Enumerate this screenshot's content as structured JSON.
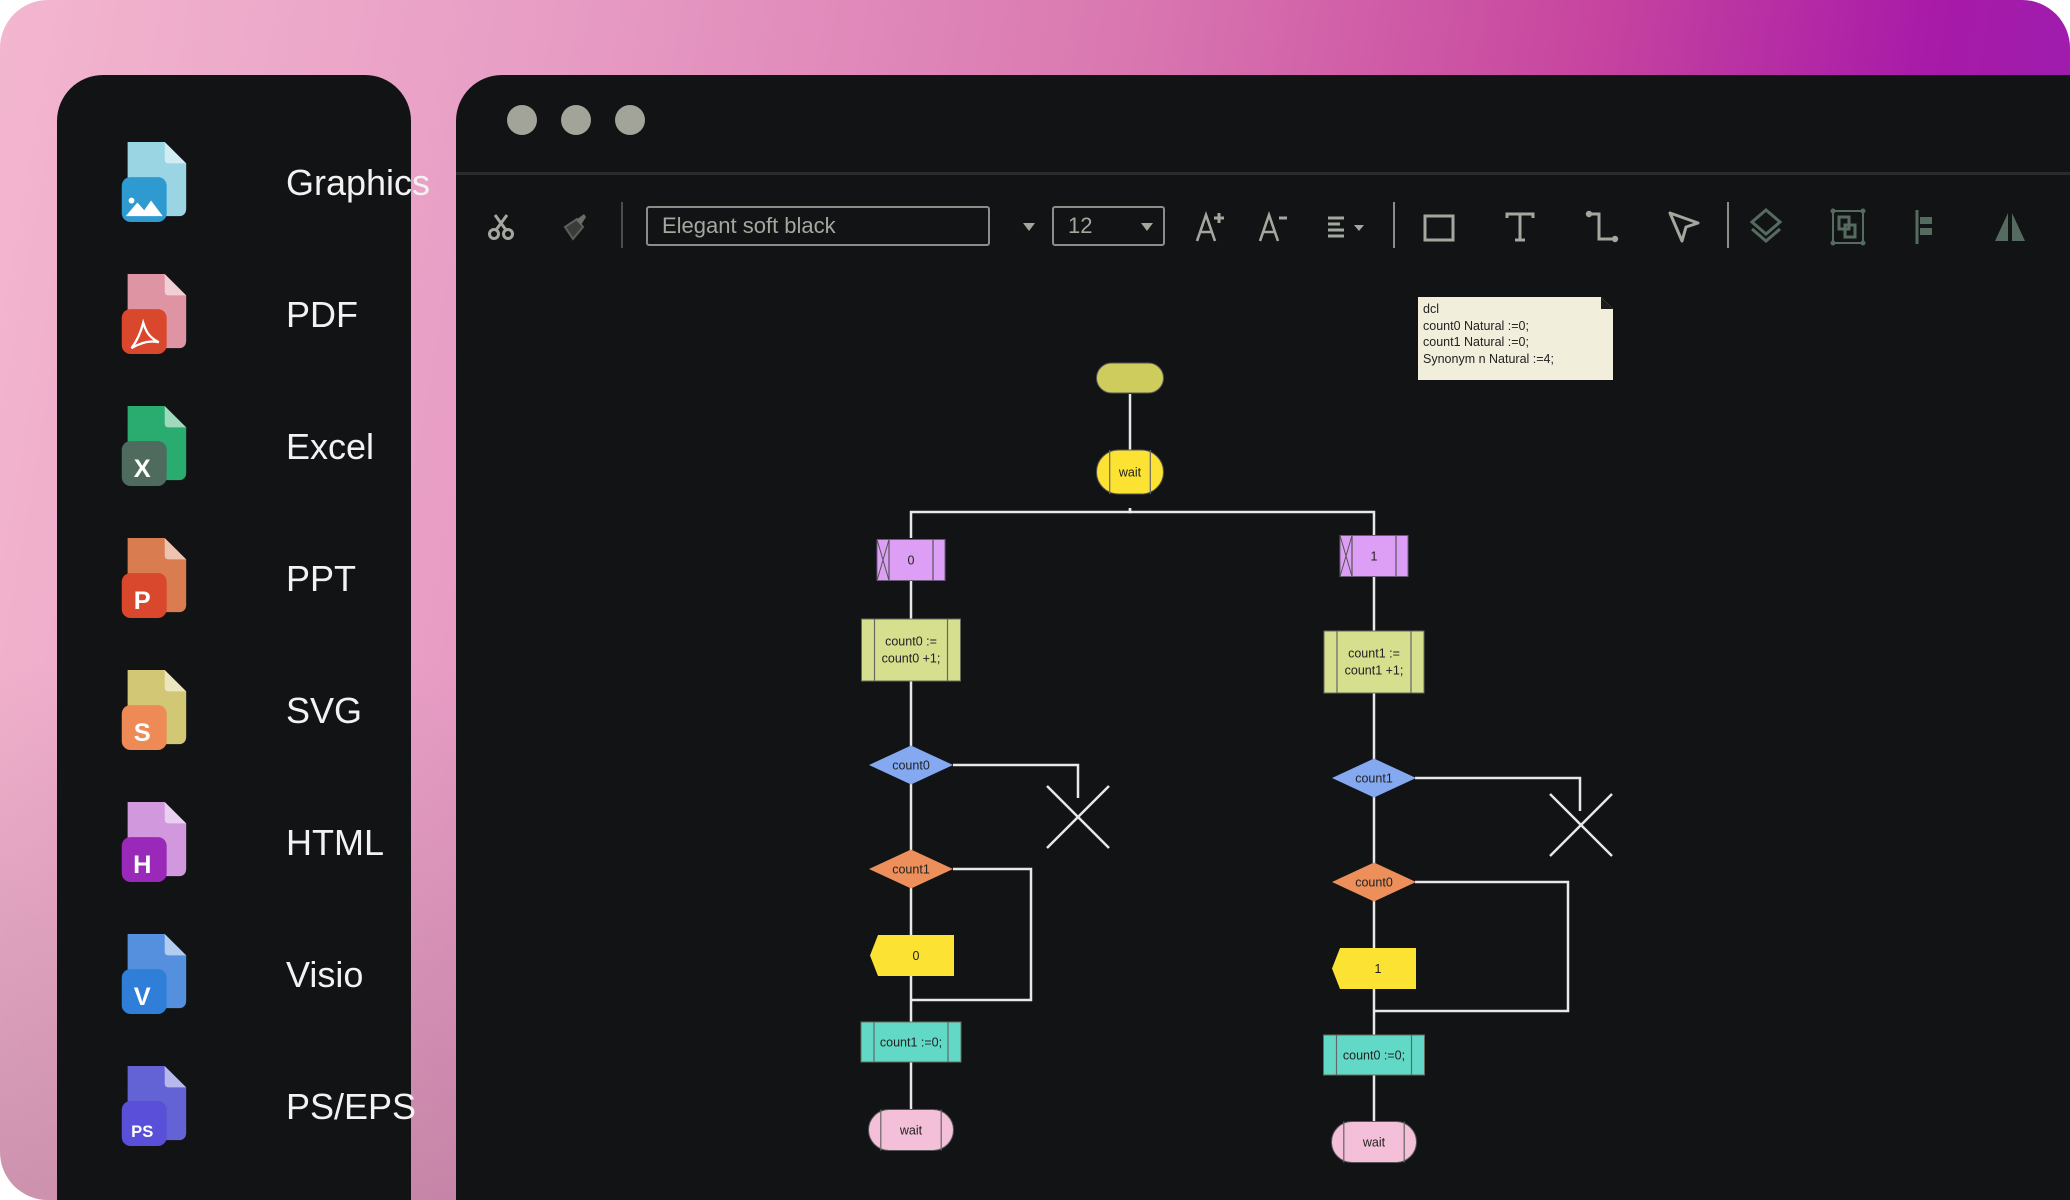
{
  "window": {
    "traffic_lights": [
      "close",
      "minimize",
      "maximize"
    ]
  },
  "sidebar": {
    "items": [
      {
        "label": "Graphics",
        "icon": "graphics-file-icon",
        "badge": "",
        "back_color": "#a6e6f5",
        "badge_color": "#2f9ad0"
      },
      {
        "label": "PDF",
        "icon": "pdf-file-icon",
        "badge": "",
        "back_color": "#f0a0b0",
        "badge_color": "#d9472c"
      },
      {
        "label": "Excel",
        "icon": "excel-file-icon",
        "badge": "X",
        "back_color": "#2db878",
        "badge_color": "#4e6b5d"
      },
      {
        "label": "PPT",
        "icon": "ppt-file-icon",
        "badge": "P",
        "back_color": "#ea8656",
        "badge_color": "#d9472c"
      },
      {
        "label": "SVG",
        "icon": "svg-file-icon",
        "badge": "S",
        "back_color": "#e3d77d",
        "badge_color": "#ee8a55"
      },
      {
        "label": "HTML",
        "icon": "html-file-icon",
        "badge": "H",
        "back_color": "#e2a4ef",
        "badge_color": "#9a28b8"
      },
      {
        "label": "Visio",
        "icon": "visio-file-icon",
        "badge": "V",
        "back_color": "#5b9bf0",
        "badge_color": "#2f7fd8"
      },
      {
        "label": "PS/EPS",
        "icon": "ps-file-icon",
        "badge": "PS",
        "back_color": "#6a6ae6",
        "badge_color": "#5a4fd8"
      }
    ]
  },
  "toolbar": {
    "font_value": "Elegant soft black",
    "font_size_value": "12",
    "tools": [
      "cut",
      "format-painter",
      "font",
      "font-size",
      "increase-font",
      "decrease-font",
      "align",
      "rectangle",
      "text",
      "connector",
      "select",
      "layers",
      "group",
      "align-left",
      "flip"
    ]
  },
  "diagram": {
    "note_lines": [
      "dcl",
      "count0 Natural :=0;",
      "count1 Natural :=0;",
      "Synonym n Natural :=4;"
    ],
    "start_label": "",
    "wait_top": "wait",
    "left": {
      "input": "0",
      "task": [
        "count0 :=",
        "count0 +1;"
      ],
      "decision1": "count0",
      "decision2": "count1",
      "output": "0",
      "task2": "count1 :=0;",
      "wait": "wait"
    },
    "right": {
      "input": "1",
      "task": [
        "count1 :=",
        "count1 +1;"
      ],
      "decision1": "count1",
      "decision2": "count0",
      "output": "1",
      "task2": "count0 :=0;",
      "wait": "wait"
    },
    "colors": {
      "start": "#cfcc5e",
      "wait_top": "#fbe233",
      "input": "#dd9ef5",
      "task": "#d6df8e",
      "decision_blue": "#84a9f0",
      "decision_orange": "#ec8f5b",
      "output": "#fbe233",
      "reset": "#62d9c6",
      "wait_end": "#f4bfd8",
      "line": "#e8e8e8",
      "note": "#f1eedc"
    }
  }
}
